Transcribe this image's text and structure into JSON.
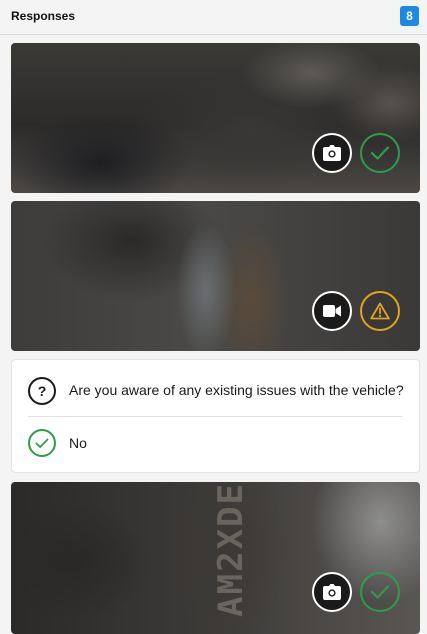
{
  "header": {
    "title": "Responses",
    "count": "8"
  },
  "responses": [
    {
      "kind": "photo",
      "media_icon": "camera-icon",
      "status": "pass",
      "status_icon": "checkmark-icon",
      "status_color": "#2e9d47"
    },
    {
      "kind": "video",
      "media_icon": "video-camera-icon",
      "status": "warning",
      "status_icon": "warning-triangle-icon",
      "status_color": "#e0a41e"
    },
    {
      "kind": "question",
      "question_icon": "question-mark-icon",
      "question_glyph": "?",
      "question": "Are you aware of any existing issues with the vehicle?",
      "answer_icon": "checkmark-icon",
      "answer": "No",
      "answer_color": "#2e9d47"
    },
    {
      "kind": "photo",
      "media_icon": "camera-icon",
      "status": "pass",
      "status_icon": "checkmark-icon",
      "status_color": "#2e9d47",
      "photo_text": "AM2XDE"
    }
  ],
  "colors": {
    "badge": "#1e88e5",
    "pass": "#2e9d47",
    "warning": "#e0a41e"
  }
}
